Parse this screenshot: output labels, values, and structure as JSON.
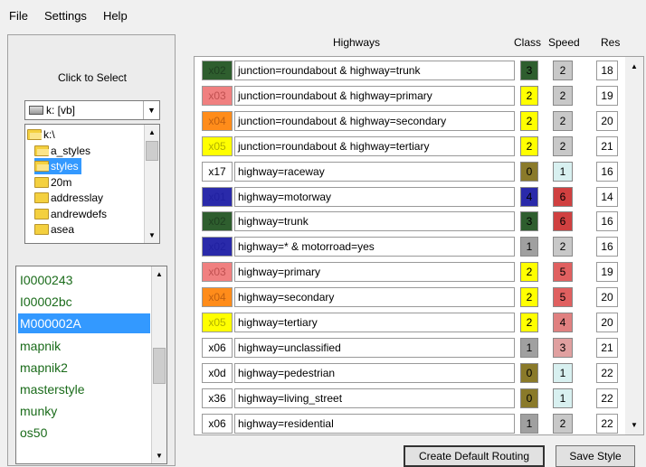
{
  "menu": [
    "File",
    "Settings",
    "Help"
  ],
  "left": {
    "click_label": "Click to Select",
    "drive": "k: [vb]",
    "dirs": [
      {
        "label": "k:\\",
        "type": "drive"
      },
      {
        "label": "a_styles",
        "type": "open"
      },
      {
        "label": "styles",
        "type": "open",
        "selected": true
      },
      {
        "label": "20m",
        "type": "folder"
      },
      {
        "label": "addresslay",
        "type": "folder"
      },
      {
        "label": "andrewdefs",
        "type": "folder"
      },
      {
        "label": "asea",
        "type": "folder"
      }
    ],
    "styles": [
      {
        "label": "I0000243"
      },
      {
        "label": "I00002bc"
      },
      {
        "label": "M000002A",
        "selected": true
      },
      {
        "label": "mapnik"
      },
      {
        "label": "mapnik2"
      },
      {
        "label": "masterstyle"
      },
      {
        "label": "munky"
      },
      {
        "label": "os50"
      }
    ]
  },
  "grid": {
    "headers": {
      "highways": "Highways",
      "class": "Class",
      "speed": "Speed",
      "res": "Res"
    },
    "rows": [
      {
        "code": "x02",
        "name": "junction=roundabout & highway=trunk",
        "cls": "3",
        "spd": "2",
        "res": "18",
        "code_bg": "#2e5e2e",
        "code_fg": "#1f4020",
        "cls_bg": "#2e5e2e",
        "spd_bg": "#c8c8c8"
      },
      {
        "code": "x03",
        "name": "junction=roundabout & highway=primary",
        "cls": "2",
        "spd": "2",
        "res": "19",
        "code_bg": "#f08080",
        "code_fg": "#c05050",
        "cls_bg": "#ffff00",
        "spd_bg": "#c8c8c8"
      },
      {
        "code": "x04",
        "name": "junction=roundabout & highway=secondary",
        "cls": "2",
        "spd": "2",
        "res": "20",
        "code_bg": "#ff8c1a",
        "code_fg": "#c06010",
        "cls_bg": "#ffff00",
        "spd_bg": "#c8c8c8"
      },
      {
        "code": "x05",
        "name": "junction=roundabout & highway=tertiary",
        "cls": "2",
        "spd": "2",
        "res": "21",
        "code_bg": "#ffff00",
        "code_fg": "#b0b000",
        "cls_bg": "#ffff00",
        "spd_bg": "#c8c8c8"
      },
      {
        "code": "x17",
        "name": "highway=raceway",
        "cls": "0",
        "spd": "1",
        "res": "16",
        "code_bg": "#ffffff",
        "code_fg": "#000000",
        "cls_bg": "#8a7a2a",
        "spd_bg": "#d8f0f0"
      },
      {
        "code": "x01",
        "name": "highway=motorway",
        "cls": "4",
        "spd": "6",
        "res": "14",
        "code_bg": "#2a2aaa",
        "code_fg": "#2020a0",
        "cls_bg": "#2a2aaa",
        "spd_bg": "#d04040"
      },
      {
        "code": "x02",
        "name": "highway=trunk",
        "cls": "3",
        "spd": "6",
        "res": "16",
        "code_bg": "#2e5e2e",
        "code_fg": "#1f4020",
        "cls_bg": "#2e5e2e",
        "spd_bg": "#d04040"
      },
      {
        "code": "x02",
        "name": "highway=* & motorroad=yes",
        "cls": "1",
        "spd": "2",
        "res": "16",
        "code_bg": "#2a2aaa",
        "code_fg": "#2020a0",
        "cls_bg": "#a0a0a0",
        "spd_bg": "#c8c8c8"
      },
      {
        "code": "x03",
        "name": "highway=primary",
        "cls": "2",
        "spd": "5",
        "res": "19",
        "code_bg": "#f08080",
        "code_fg": "#c05050",
        "cls_bg": "#ffff00",
        "spd_bg": "#e06060"
      },
      {
        "code": "x04",
        "name": "highway=secondary",
        "cls": "2",
        "spd": "5",
        "res": "20",
        "code_bg": "#ff8c1a",
        "code_fg": "#c06010",
        "cls_bg": "#ffff00",
        "spd_bg": "#e06060"
      },
      {
        "code": "x05",
        "name": "highway=tertiary",
        "cls": "2",
        "spd": "4",
        "res": "20",
        "code_bg": "#ffff00",
        "code_fg": "#b0b000",
        "cls_bg": "#ffff00",
        "spd_bg": "#e08080"
      },
      {
        "code": "x06",
        "name": "highway=unclassified",
        "cls": "1",
        "spd": "3",
        "res": "21",
        "code_bg": "#ffffff",
        "code_fg": "#000000",
        "cls_bg": "#a0a0a0",
        "spd_bg": "#e0a0a0"
      },
      {
        "code": "x0d",
        "name": "highway=pedestrian",
        "cls": "0",
        "spd": "1",
        "res": "22",
        "code_bg": "#ffffff",
        "code_fg": "#000000",
        "cls_bg": "#8a7a2a",
        "spd_bg": "#d8f0f0"
      },
      {
        "code": "x36",
        "name": "highway=living_street",
        "cls": "0",
        "spd": "1",
        "res": "22",
        "code_bg": "#ffffff",
        "code_fg": "#000000",
        "cls_bg": "#8a7a2a",
        "spd_bg": "#d8f0f0"
      },
      {
        "code": "x06",
        "name": "highway=residential",
        "cls": "1",
        "spd": "2",
        "res": "22",
        "code_bg": "#ffffff",
        "code_fg": "#000000",
        "cls_bg": "#a0a0a0",
        "spd_bg": "#c8c8c8"
      }
    ]
  },
  "buttons": {
    "default_routing": "Create Default Routing",
    "save_style": "Save Style"
  }
}
